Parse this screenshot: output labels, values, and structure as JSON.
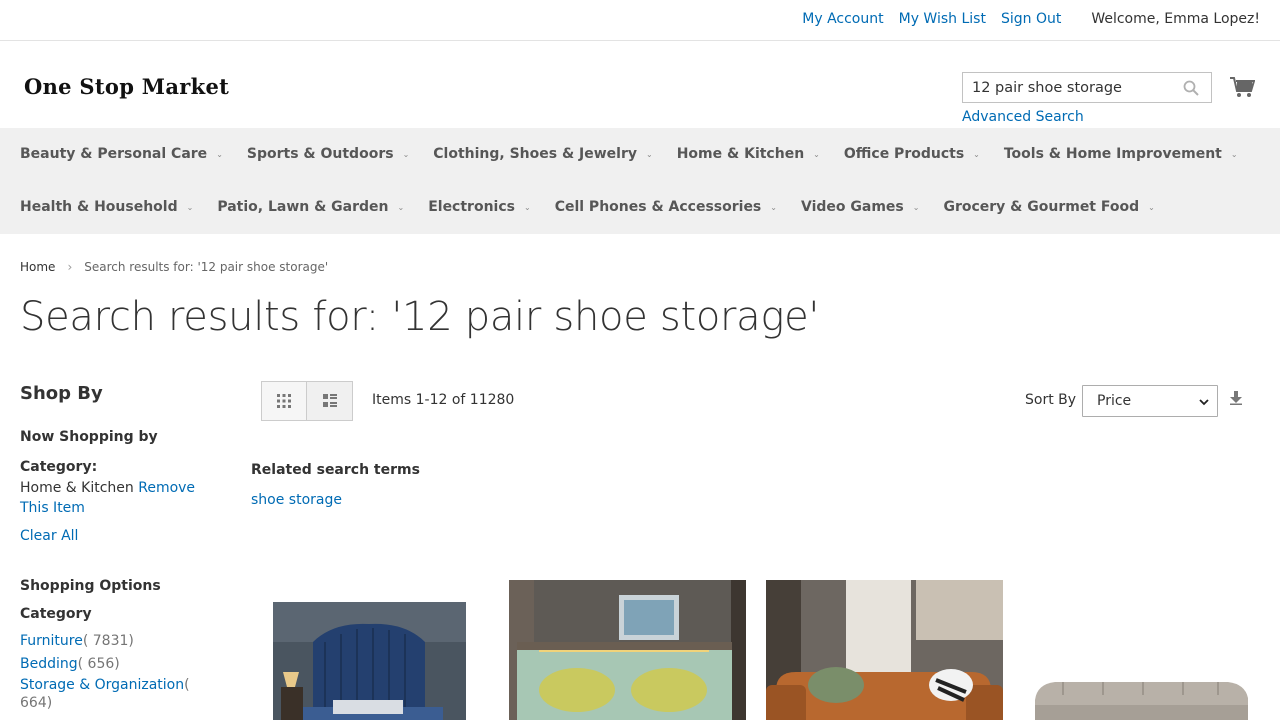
{
  "header": {
    "links": {
      "my_account": "My Account",
      "wish_list": "My Wish List",
      "sign_out": "Sign Out"
    },
    "welcome": "Welcome, Emma Lopez!",
    "logo_text": "One Stop Market",
    "search_value": "12 pair shoe storage",
    "advanced_search": "Advanced Search"
  },
  "nav": {
    "row1": [
      "Beauty & Personal Care",
      "Sports & Outdoors",
      "Clothing, Shoes & Jewelry",
      "Home & Kitchen",
      "Office Products",
      "Tools & Home Improvement"
    ],
    "row2": [
      "Health & Household",
      "Patio, Lawn & Garden",
      "Electronics",
      "Cell Phones & Accessories",
      "Video Games",
      "Grocery & Gourmet Food"
    ]
  },
  "breadcrumb": {
    "home": "Home",
    "current": "Search results for: '12 pair shoe storage'"
  },
  "page_title": "Search results for: '12 pair shoe storage'",
  "sidebar": {
    "shop_by": "Shop By",
    "now_shopping": "Now Shopping by",
    "filter_label": "Category:",
    "filter_value": "Home & Kitchen",
    "remove_item": "Remove This Item",
    "clear_all": "Clear All",
    "shopping_options": "Shopping Options",
    "category_title": "Category",
    "categories": [
      {
        "name": "Furniture",
        "count": "( 7831)"
      },
      {
        "name": "Bedding",
        "count": "( 656)"
      },
      {
        "name": "Storage & Organization",
        "count_a": "(",
        "count_b": "664)"
      }
    ]
  },
  "toolbar": {
    "amount": "Items 1-12 of 11280",
    "sort_label": "Sort By",
    "sort_value": "Price"
  },
  "related": {
    "title": "Related search terms",
    "terms": [
      "shoe storage"
    ]
  },
  "colors": {
    "link": "#006bb4",
    "nav_bg": "#f0f0f0"
  }
}
